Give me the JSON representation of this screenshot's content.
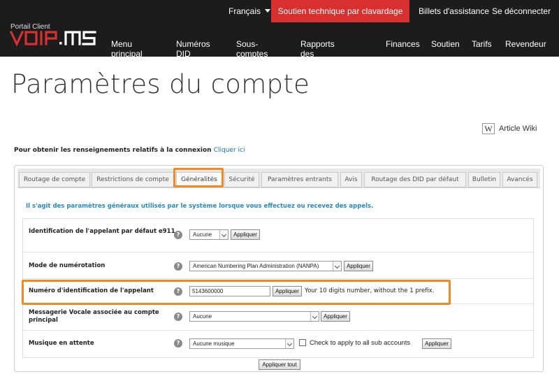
{
  "topbar": {
    "language": "Français",
    "chat_support": "Soutien technique par clavardage",
    "tickets": "Billets d'assistance",
    "logout": "Se déconnecter"
  },
  "brand": {
    "portal_label": "Portail Client",
    "logo_text": "VOIP.MS"
  },
  "nav": {
    "items": [
      "Menu principal",
      "Numéros DID",
      "Sous-comptes",
      "Rapports des appels",
      "Finances",
      "Soutien",
      "Tarifs",
      "Revendeur"
    ]
  },
  "page": {
    "title": "Paramètres du compte",
    "wiki_link": "Article Wiki",
    "connection_info": "Pour obtenir les renseignements relatifs à la connexion",
    "connection_link": "Cliquer ici"
  },
  "tabs": [
    {
      "label": "Routage de compte",
      "active": false
    },
    {
      "label": "Restrictions de compte",
      "active": false
    },
    {
      "label": "Généralités",
      "active": true
    },
    {
      "label": "Sécurité",
      "active": false
    },
    {
      "label": "Paramètres entrants",
      "active": false
    },
    {
      "label": "Avis",
      "active": false
    },
    {
      "label": "Routage des DID par défaut",
      "active": false
    },
    {
      "label": "Bulletin",
      "active": false
    },
    {
      "label": "Avancés",
      "active": false
    }
  ],
  "general": {
    "description": "Il s'agit des paramètres généraux utilisés par le système lorsque vous effectuez ou recevez des appels.",
    "apply_label": "Appliquer",
    "apply_all_label": "Appliquer tout",
    "help_glyph": "?",
    "rows": {
      "e911": {
        "label": "Identification de l'appelant par défaut e911",
        "value": "Aucune"
      },
      "dialing_mode": {
        "label": "Mode de numérotation",
        "value": "American Numbering Plan Administration (NANPA)"
      },
      "caller_id": {
        "label": "Numéro d'identification de l'appelant",
        "value": "5143600000",
        "hint": "Your 10 digits number, without the 1 prefix."
      },
      "voicemail": {
        "label": "Messagerie Vocale associée au compte principal",
        "value": "Aucune"
      },
      "music": {
        "label": "Musique en attente",
        "value": "Aucune musique",
        "checkbox_label": "Check to apply to all sub accounts",
        "checked": false
      }
    }
  },
  "colors": {
    "header_bg": "#1c1c1c",
    "chat_bg": "#d8302f",
    "highlight": "#f08a24",
    "link": "#1a6bb5",
    "description": "#2a89c4"
  }
}
